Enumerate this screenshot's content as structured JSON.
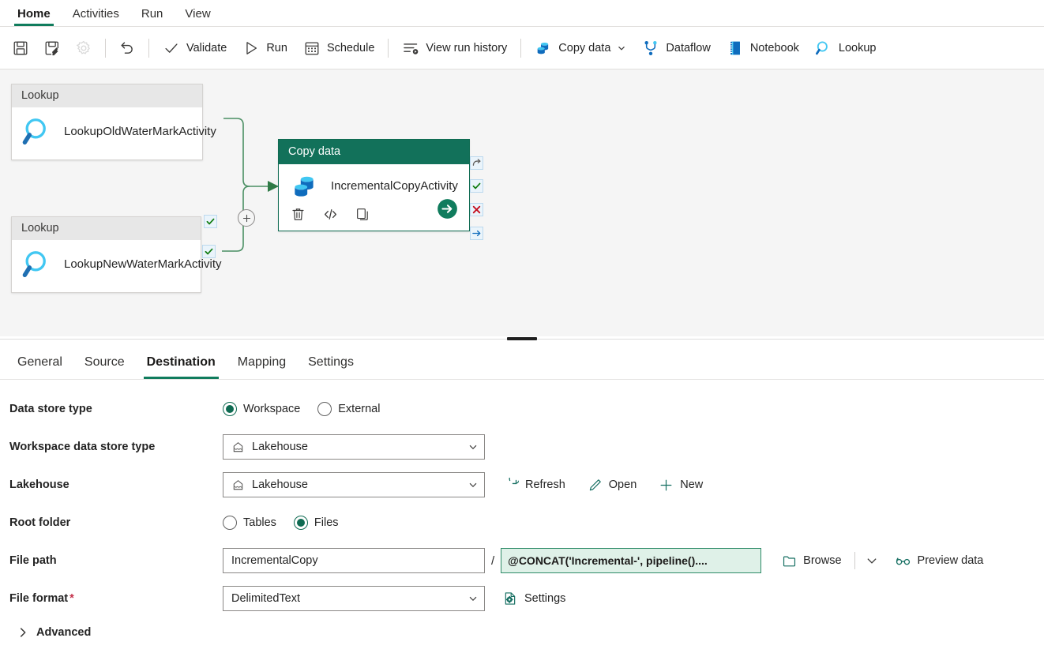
{
  "ribbon": {
    "tabs": [
      {
        "label": "Home",
        "active": true
      },
      {
        "label": "Activities",
        "active": false
      },
      {
        "label": "Run",
        "active": false
      },
      {
        "label": "View",
        "active": false
      }
    ]
  },
  "toolbar": {
    "save_label": "",
    "save_as_label": "",
    "settings_label": "",
    "undo_label": "",
    "validate_label": "Validate",
    "run_label": "Run",
    "schedule_label": "Schedule",
    "view_run_history_label": "View run history",
    "copy_data_label": "Copy data",
    "dataflow_label": "Dataflow",
    "notebook_label": "Notebook",
    "lookup_label": "Lookup"
  },
  "canvas": {
    "nodes": [
      {
        "type": "Lookup",
        "name": "LookupOldWaterMarkActivity"
      },
      {
        "type": "Lookup",
        "name": "LookupNewWaterMarkActivity"
      },
      {
        "type": "Copy data",
        "name": "IncrementalCopyActivity"
      }
    ],
    "lookup1_header": "Lookup",
    "lookup1_name": "LookupOldWaterMarkActivity",
    "lookup2_header": "Lookup",
    "lookup2_name": "LookupNewWaterMarkActivity",
    "copy_header": "Copy data",
    "copy_name": "IncrementalCopyActivity"
  },
  "properties": {
    "tabs": [
      {
        "label": "General",
        "active": false
      },
      {
        "label": "Source",
        "active": false
      },
      {
        "label": "Destination",
        "active": true
      },
      {
        "label": "Mapping",
        "active": false
      },
      {
        "label": "Settings",
        "active": false
      }
    ],
    "data_store_type": {
      "label": "Data store type",
      "options": [
        "Workspace",
        "External"
      ],
      "selected": "Workspace"
    },
    "workspace_data_store_type": {
      "label": "Workspace data store type",
      "value": "Lakehouse"
    },
    "lakehouse": {
      "label": "Lakehouse",
      "value": "Lakehouse",
      "refresh_label": "Refresh",
      "open_label": "Open",
      "new_label": "New"
    },
    "root_folder": {
      "label": "Root folder",
      "options": [
        "Tables",
        "Files"
      ],
      "selected": "Files"
    },
    "file_path": {
      "label": "File path",
      "folder_value": "IncrementalCopy",
      "separator": "/",
      "expression_value": "@CONCAT('Incremental-', pipeline()....",
      "browse_label": "Browse",
      "preview_label": "Preview data"
    },
    "file_format": {
      "label": "File format",
      "required": "*",
      "value": "DelimitedText",
      "settings_label": "Settings"
    },
    "advanced": {
      "label": "Advanced"
    }
  },
  "colors": {
    "accent_green": "#107c5d",
    "copy_node_header": "#12715a",
    "expression_bg": "#dff1e8",
    "connector": "#4a8f63",
    "required_red": "#c4314b",
    "icon_blue": "#0f6cbd",
    "lookup_icon_cyan": "#41c7f2"
  }
}
